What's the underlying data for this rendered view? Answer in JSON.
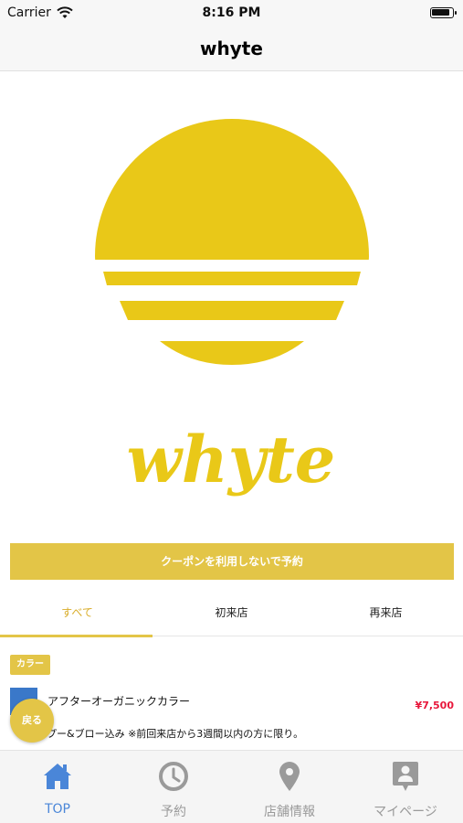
{
  "status_bar": {
    "carrier": "Carrier",
    "time": "8:16 PM"
  },
  "nav": {
    "title": "whyte"
  },
  "brand": {
    "logo_text": "whyte",
    "accent_color": "#e3c547"
  },
  "reserve_button": {
    "label": "クーポンを利用しないで予約"
  },
  "filter_tabs": [
    {
      "label": "すべて",
      "active": true
    },
    {
      "label": "初来店",
      "active": false
    },
    {
      "label": "再来店",
      "active": false
    }
  ],
  "coupon_section": {
    "category": "カラー",
    "coupon": {
      "name": "アフターオーガニックカラー",
      "price": "¥7,500",
      "description": "プー&ブロー込み ※前回来店から3週間以内の方に限り。"
    }
  },
  "back_button": {
    "label": "戻る"
  },
  "tab_bar": [
    {
      "label": "TOP",
      "icon": "home-icon",
      "active": true
    },
    {
      "label": "予約",
      "icon": "clock-icon",
      "active": false
    },
    {
      "label": "店舗情報",
      "icon": "map-pin-icon",
      "active": false
    },
    {
      "label": "マイページ",
      "icon": "profile-icon",
      "active": false
    }
  ]
}
